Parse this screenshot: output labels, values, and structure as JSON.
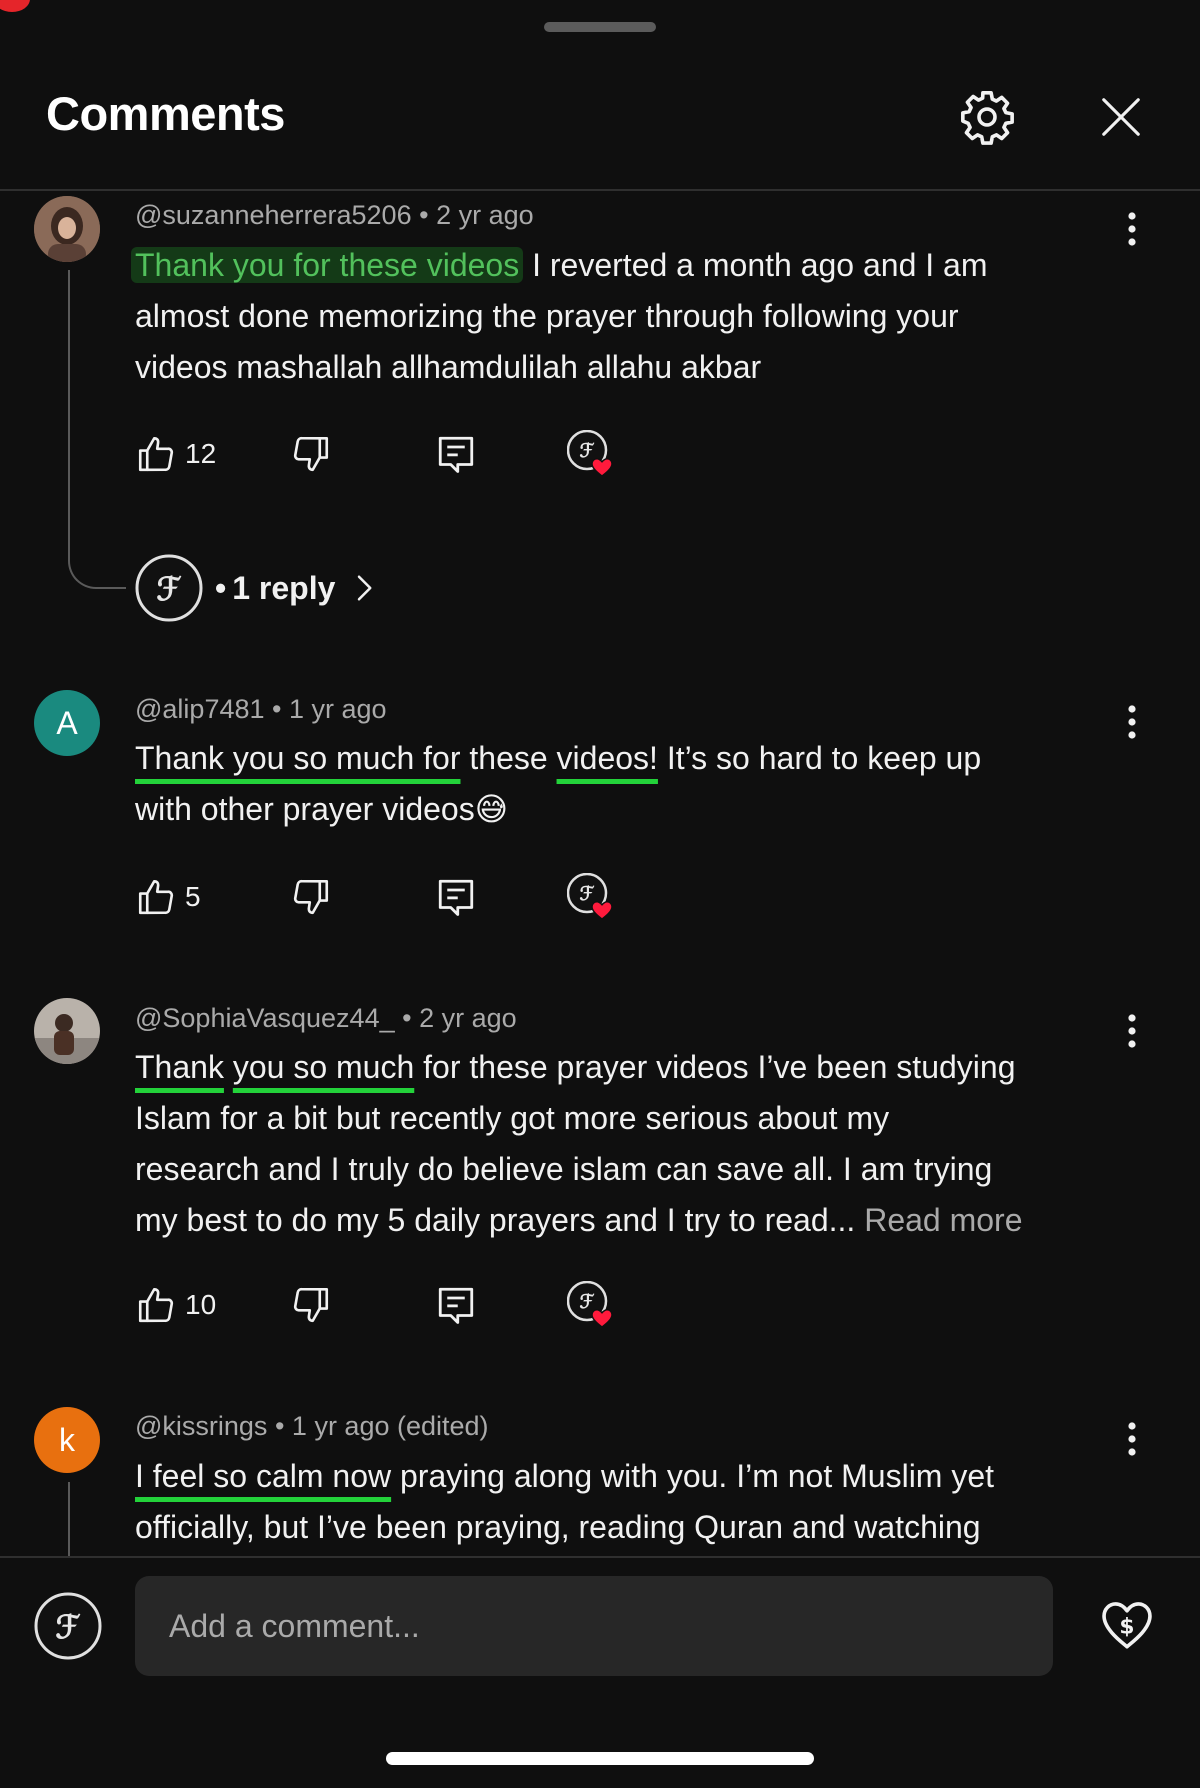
{
  "header": {
    "title": "Comments"
  },
  "comments": [
    {
      "author": "@suzanneherrera5206",
      "time": "2 yr ago",
      "text_highlight": "Thank you for these videos",
      "line1_rest": " I reverted a month ago and I am",
      "line2": "almost done memorizing the prayer through following your",
      "line3": "videos mashallah allhamdulilah  allahu akbar",
      "likes": "12",
      "replies_label": "1 reply"
    },
    {
      "author": "@alip7481",
      "time": "1 yr ago",
      "avatar_letter": "A",
      "avatar_color": "#1a8a7f",
      "seg1": "Thank you so much for",
      "seg2": " these ",
      "seg3": "videos!",
      "seg4": " It’s so hard to keep up",
      "line2": "with other prayer videos",
      "emoji": "😅",
      "likes": "5"
    },
    {
      "author": "@SophiaVasquez44_",
      "time": "2 yr ago",
      "seg1": "Thank",
      "seg2": " ",
      "seg3": "you so much",
      "seg4": " for these prayer videos I’ve been studying",
      "line2": "Islam for a bit but recently got more serious about my",
      "line3": "research and I truly do believe islam can save all. I am trying",
      "line4": "my best to do my 5 daily prayers and I try to read...",
      "read_more": "Read more",
      "likes": "10"
    },
    {
      "author": "@kissrings",
      "time": "1 yr ago (edited)",
      "avatar_letter": "k",
      "avatar_color": "#e8700f",
      "seg1": "I feel so calm now",
      "seg2": " praying along  with you. I’m not Muslim yet",
      "line2": "officially, but I’ve been praying, reading Quran and watching"
    }
  ],
  "footer": {
    "placeholder": "Add a comment..."
  },
  "colors": {
    "highlight_text": "#52c15c",
    "underline": "#23d23a",
    "heart": "#ff1a3c"
  },
  "icons": [
    "gear-icon",
    "close-icon",
    "more-vert-icon",
    "like-icon",
    "dislike-icon",
    "reply-icon",
    "creator-heart-icon",
    "chevron-right-icon",
    "thanks-heart-icon"
  ]
}
